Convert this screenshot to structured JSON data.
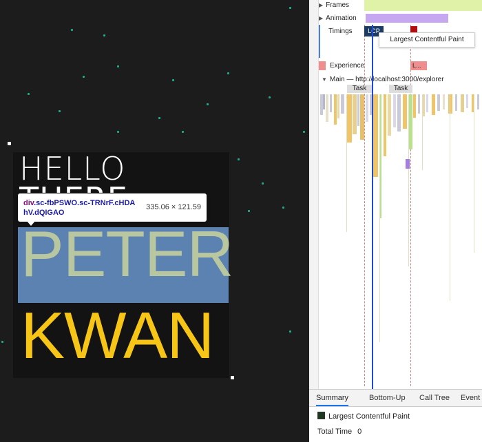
{
  "preview": {
    "hello": "HELLO",
    "there": "THERE",
    "first_name": "PETER",
    "last_name": "KWAN",
    "tooltip": {
      "tag": "div",
      "classes": ".sc-fbPSWO.sc-TRNrF.cHDAhV.dQIGAO",
      "size": "335.06 × 121.59"
    },
    "colors": {
      "highlight": "#6fa2de",
      "first_name": "#b9c7a0",
      "last_name": "#f6c515",
      "stars": "#1fd1a8"
    }
  },
  "performance": {
    "tracks": {
      "frames": "Frames",
      "animation": "Animation",
      "timings": "Timings",
      "experience": "Experience",
      "main": "Main — http://localhost:3000/explorer"
    },
    "lcp_chip": "LCP",
    "lcp_tooltip": "Largest Contentful Paint",
    "experience_chip": "L...",
    "task_label_1": "Task",
    "task_label_2": "Task"
  },
  "bottom_panel": {
    "tabs": [
      "Summary",
      "Bottom-Up",
      "Call Tree",
      "Event"
    ],
    "active_tab": "Summary",
    "summary_title": "Largest Contentful Paint",
    "total_time_label": "Total Time",
    "total_time_value": "0"
  }
}
